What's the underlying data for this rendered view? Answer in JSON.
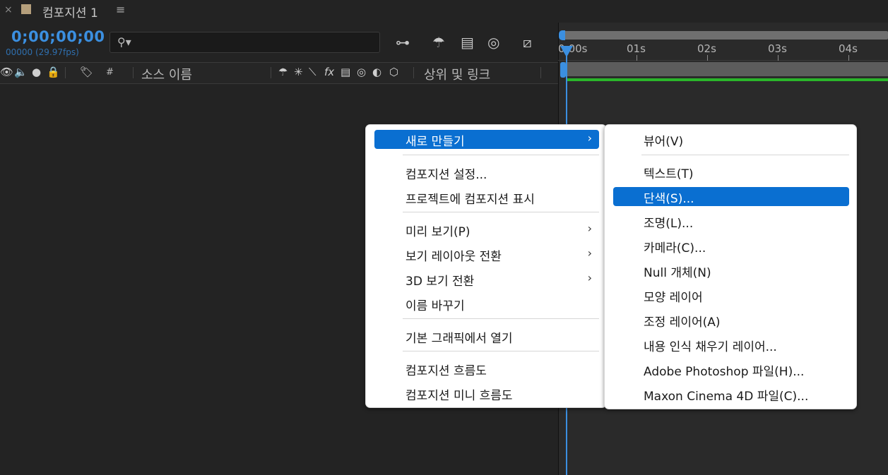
{
  "tab": {
    "close": "×",
    "title": "컴포지션 1",
    "menu_icon": "≡"
  },
  "timecode": {
    "value": "0;00;00;00",
    "frames": "00000 (29.97fps)"
  },
  "search": {
    "placeholder": "",
    "icon": "search-icon"
  },
  "toolbar_icons": [
    "draft-3d-icon",
    "shy-icon",
    "frame-blending-icon",
    "motion-blur-icon",
    "graph-editor-icon"
  ],
  "layer_header": {
    "source_name": "소스 이름",
    "parent_link": "상위 및 링크",
    "hash": "#"
  },
  "ruler": {
    "labels": [
      "0:00s",
      "01s",
      "02s",
      "03s",
      "04s"
    ]
  },
  "colors": {
    "accent": "#0a6fd1",
    "timecode": "#3b8fe0",
    "green": "#2ab52a"
  },
  "context_menu": {
    "items": [
      {
        "label": "새로 만들기",
        "submenu": true,
        "selected": true
      },
      {
        "label": "컴포지션 설정..."
      },
      {
        "label": "프로젝트에 컴포지션 표시"
      },
      {
        "label": "미리 보기(P)",
        "submenu": true
      },
      {
        "label": "보기 레이아웃 전환",
        "submenu": true
      },
      {
        "label": "3D 보기 전환",
        "submenu": true
      },
      {
        "label": "이름 바꾸기"
      },
      {
        "label": "기본 그래픽에서 열기"
      },
      {
        "label": "컴포지션 흐름도"
      },
      {
        "label": "컴포지션 미니 흐름도"
      }
    ]
  },
  "submenu": {
    "items": [
      {
        "label": "뷰어(V)"
      },
      {
        "label": "텍스트(T)"
      },
      {
        "label": "단색(S)...",
        "selected": true
      },
      {
        "label": "조명(L)..."
      },
      {
        "label": "카메라(C)..."
      },
      {
        "label": "Null 개체(N)"
      },
      {
        "label": "모양 레이어"
      },
      {
        "label": "조정 레이어(A)"
      },
      {
        "label": "내용 인식 채우기 레이어..."
      },
      {
        "label": "Adobe Photoshop 파일(H)..."
      },
      {
        "label": "Maxon Cinema 4D 파일(C)..."
      }
    ]
  }
}
